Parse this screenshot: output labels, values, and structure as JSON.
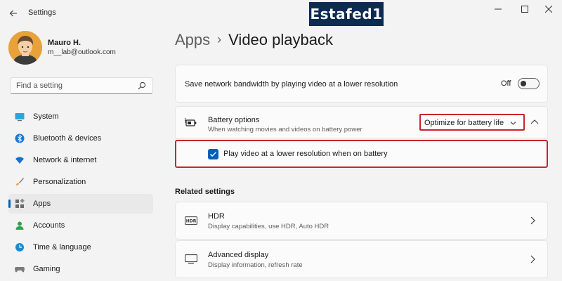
{
  "window": {
    "title": "Settings",
    "watermark": "Estafed1"
  },
  "user": {
    "name": "Mauro H.",
    "email": "m__lab@outlook.com"
  },
  "search": {
    "placeholder": "Find a setting"
  },
  "sidebar": {
    "items": [
      {
        "label": "System",
        "icon": "system-icon"
      },
      {
        "label": "Bluetooth & devices",
        "icon": "bluetooth-icon"
      },
      {
        "label": "Network & internet",
        "icon": "wifi-icon"
      },
      {
        "label": "Personalization",
        "icon": "brush-icon"
      },
      {
        "label": "Apps",
        "icon": "apps-icon",
        "active": true
      },
      {
        "label": "Accounts",
        "icon": "person-icon"
      },
      {
        "label": "Time & language",
        "icon": "globe-clock-icon"
      },
      {
        "label": "Gaming",
        "icon": "gamepad-icon"
      }
    ]
  },
  "breadcrumb": {
    "parent": "Apps",
    "separator": "›",
    "current": "Video playback"
  },
  "bandwidth": {
    "label": "Save network bandwidth by playing video at a lower resolution",
    "state": "Off",
    "on": false
  },
  "battery": {
    "title": "Battery options",
    "subtitle": "When watching movies and videos on battery power",
    "selected": "Optimize for battery life",
    "expanded": true
  },
  "lowres": {
    "label": "Play video at a lower resolution when on battery",
    "checked": true
  },
  "related": {
    "heading": "Related settings",
    "items": [
      {
        "title": "HDR",
        "subtitle": "Display capabilities, use HDR, Auto HDR",
        "icon": "hdr-icon"
      },
      {
        "title": "Advanced display",
        "subtitle": "Display information, refresh rate",
        "icon": "monitor-icon"
      }
    ]
  },
  "colors": {
    "accent": "#005fb8",
    "highlight": "#c9252c",
    "watermark_bg": "#0d2a52"
  }
}
